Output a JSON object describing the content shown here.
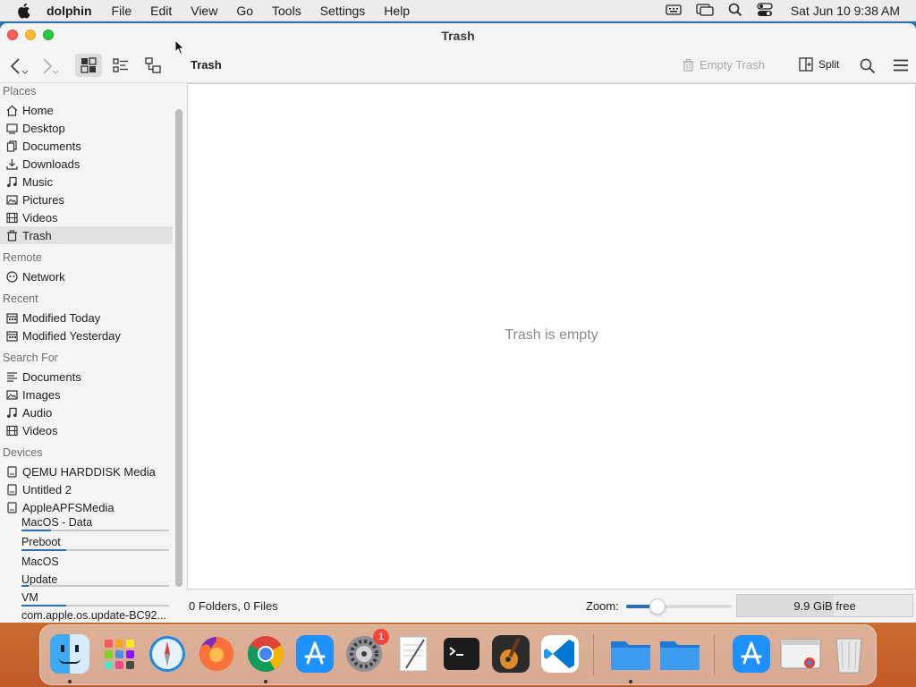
{
  "menubar": {
    "app_name": "dolphin",
    "menus": [
      "File",
      "Edit",
      "View",
      "Go",
      "Tools",
      "Settings",
      "Help"
    ],
    "clock": "Sat Jun 10  9:38 AM",
    "status_icons": [
      "keyboard-input-icon",
      "screen-mirroring-icon",
      "spotlight-search-icon",
      "control-center-icon"
    ]
  },
  "window": {
    "title": "Trash"
  },
  "toolbar": {
    "location": "Trash",
    "empty_trash_label": "Empty Trash",
    "split_label": "Split",
    "active_view_mode": "icons"
  },
  "sidebar": {
    "places_title": "Places",
    "places": [
      {
        "label": "Home",
        "icon": "home-icon"
      },
      {
        "label": "Desktop",
        "icon": "desktop-icon"
      },
      {
        "label": "Documents",
        "icon": "documents-icon"
      },
      {
        "label": "Downloads",
        "icon": "downloads-icon"
      },
      {
        "label": "Music",
        "icon": "music-icon"
      },
      {
        "label": "Pictures",
        "icon": "pictures-icon"
      },
      {
        "label": "Videos",
        "icon": "videos-icon"
      },
      {
        "label": "Trash",
        "icon": "trash-icon",
        "selected": true
      }
    ],
    "remote_title": "Remote",
    "remote": [
      {
        "label": "Network",
        "icon": "network-icon"
      }
    ],
    "recent_title": "Recent",
    "recent": [
      {
        "label": "Modified Today",
        "icon": "calendar-icon"
      },
      {
        "label": "Modified Yesterday",
        "icon": "calendar-icon"
      }
    ],
    "search_title": "Search For",
    "search": [
      {
        "label": "Documents",
        "icon": "text-document-icon"
      },
      {
        "label": "Images",
        "icon": "image-icon"
      },
      {
        "label": "Audio",
        "icon": "music-icon"
      },
      {
        "label": "Videos",
        "icon": "videos-icon"
      }
    ],
    "devices_title": "Devices",
    "devices": [
      {
        "label": "QEMU HARDDISK Media",
        "icon": "drive-icon"
      },
      {
        "label": "Untitled 2",
        "icon": "drive-icon"
      },
      {
        "label": "AppleAPFSMedia",
        "icon": "drive-icon"
      }
    ],
    "volumes": [
      {
        "label": "MacOS - Data",
        "usage": 0.2
      },
      {
        "label": "Preboot",
        "usage": 0.3
      },
      {
        "label": "MacOS",
        "usage": null
      },
      {
        "label": "Update",
        "usage": 0.05
      },
      {
        "label": "VM",
        "usage": 0.3
      },
      {
        "label": "com.apple.os.update-BC92...",
        "usage": null
      }
    ]
  },
  "content": {
    "empty_message": "Trash is empty"
  },
  "statusbar": {
    "counts": "0 Folders, 0 Files",
    "zoom_label": "Zoom:",
    "zoom_level": 0.3,
    "free_space": "9.9 GiB free",
    "free_usage": 0.55
  },
  "dock": {
    "apps": [
      {
        "name": "finder-icon",
        "running": true
      },
      {
        "name": "launchpad-icon",
        "running": false
      },
      {
        "name": "safari-icon",
        "running": false
      },
      {
        "name": "firefox-icon",
        "running": false
      },
      {
        "name": "chrome-icon",
        "running": true
      },
      {
        "name": "app-store-icon",
        "running": false
      },
      {
        "name": "system-settings-icon",
        "running": false,
        "badge": "1"
      },
      {
        "name": "textedit-icon",
        "running": false
      },
      {
        "name": "terminal-icon",
        "running": false
      },
      {
        "name": "garageband-icon",
        "running": false
      },
      {
        "name": "vscode-icon",
        "running": false
      },
      {
        "name": "folder-icon",
        "running": true
      },
      {
        "name": "folder-icon",
        "running": false
      },
      {
        "name": "app-store-icon",
        "running": false
      },
      {
        "name": "chrome-window-icon",
        "running": false
      },
      {
        "name": "dock-trash-icon",
        "running": false
      }
    ]
  },
  "colors": {
    "accent": "#2a6fb5",
    "close": "#fe5f57",
    "minimize": "#febc2e",
    "zoom": "#28c840"
  }
}
